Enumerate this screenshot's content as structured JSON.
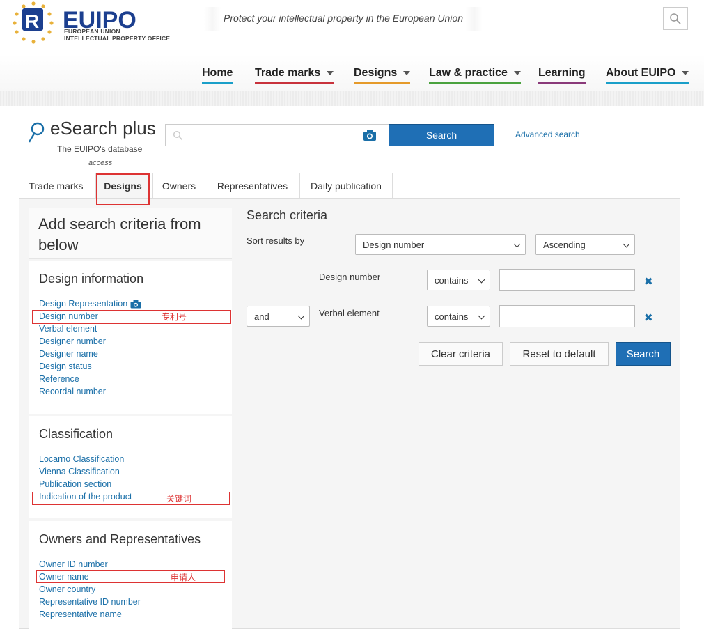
{
  "header": {
    "logo_main": "EUIPO",
    "logo_sub1": "EUROPEAN UNION",
    "logo_sub2": "INTELLECTUAL PROPERTY OFFICE",
    "tagline": "Protect your intellectual property in the European Union",
    "search_icon": "search-icon"
  },
  "nav": [
    {
      "label": "Home",
      "underline": "#1a9fc9"
    },
    {
      "label": "Trade marks",
      "underline": "#c8323c"
    },
    {
      "label": "Designs",
      "underline": "#e59a2a"
    },
    {
      "label": "Law & practice",
      "underline": "#4aa23e"
    },
    {
      "label": "Learning",
      "underline": "#8a3a7a"
    },
    {
      "label": "About EUIPO",
      "underline": "#1a9fc9"
    }
  ],
  "esearch": {
    "title": "eSearch plus",
    "subtitle": "The EUIPO's database",
    "subtitle2": "access",
    "search_button": "Search",
    "advanced": "Advanced search"
  },
  "tabs": [
    "Trade marks",
    "Designs",
    "Owners",
    "Representatives",
    "Daily publication"
  ],
  "left": {
    "title": "Add search criteria from below",
    "sections": [
      {
        "heading": "Design information",
        "links": [
          "Design Representation",
          "Design number",
          "Verbal element",
          "Designer number",
          "Designer name",
          "Design status",
          "Reference",
          "Recordal number"
        ]
      },
      {
        "heading": "Classification",
        "links": [
          "Locarno Classification",
          "Vienna Classification",
          "Publication section",
          "Indication of the product"
        ]
      },
      {
        "heading": "Owners and Representatives",
        "links": [
          "Owner ID number",
          "Owner name",
          "Owner country",
          "Representative ID number",
          "Representative name"
        ]
      }
    ],
    "notes": [
      "专利号",
      "关键词",
      "申请人"
    ]
  },
  "criteria": {
    "title": "Search criteria",
    "sort_label": "Sort results by",
    "sort_field": "Design number",
    "sort_order": "Ascending",
    "rows": [
      {
        "connector": "",
        "label": "Design number",
        "op": "contains",
        "value": ""
      },
      {
        "connector": "and",
        "label": "Verbal element",
        "op": "contains",
        "value": ""
      }
    ],
    "buttons": [
      "Clear criteria",
      "Reset to default",
      "Search"
    ]
  },
  "colors": {
    "accent": "#1f6fb5",
    "link": "#1a6fa8",
    "annotation": "#dd3333"
  }
}
